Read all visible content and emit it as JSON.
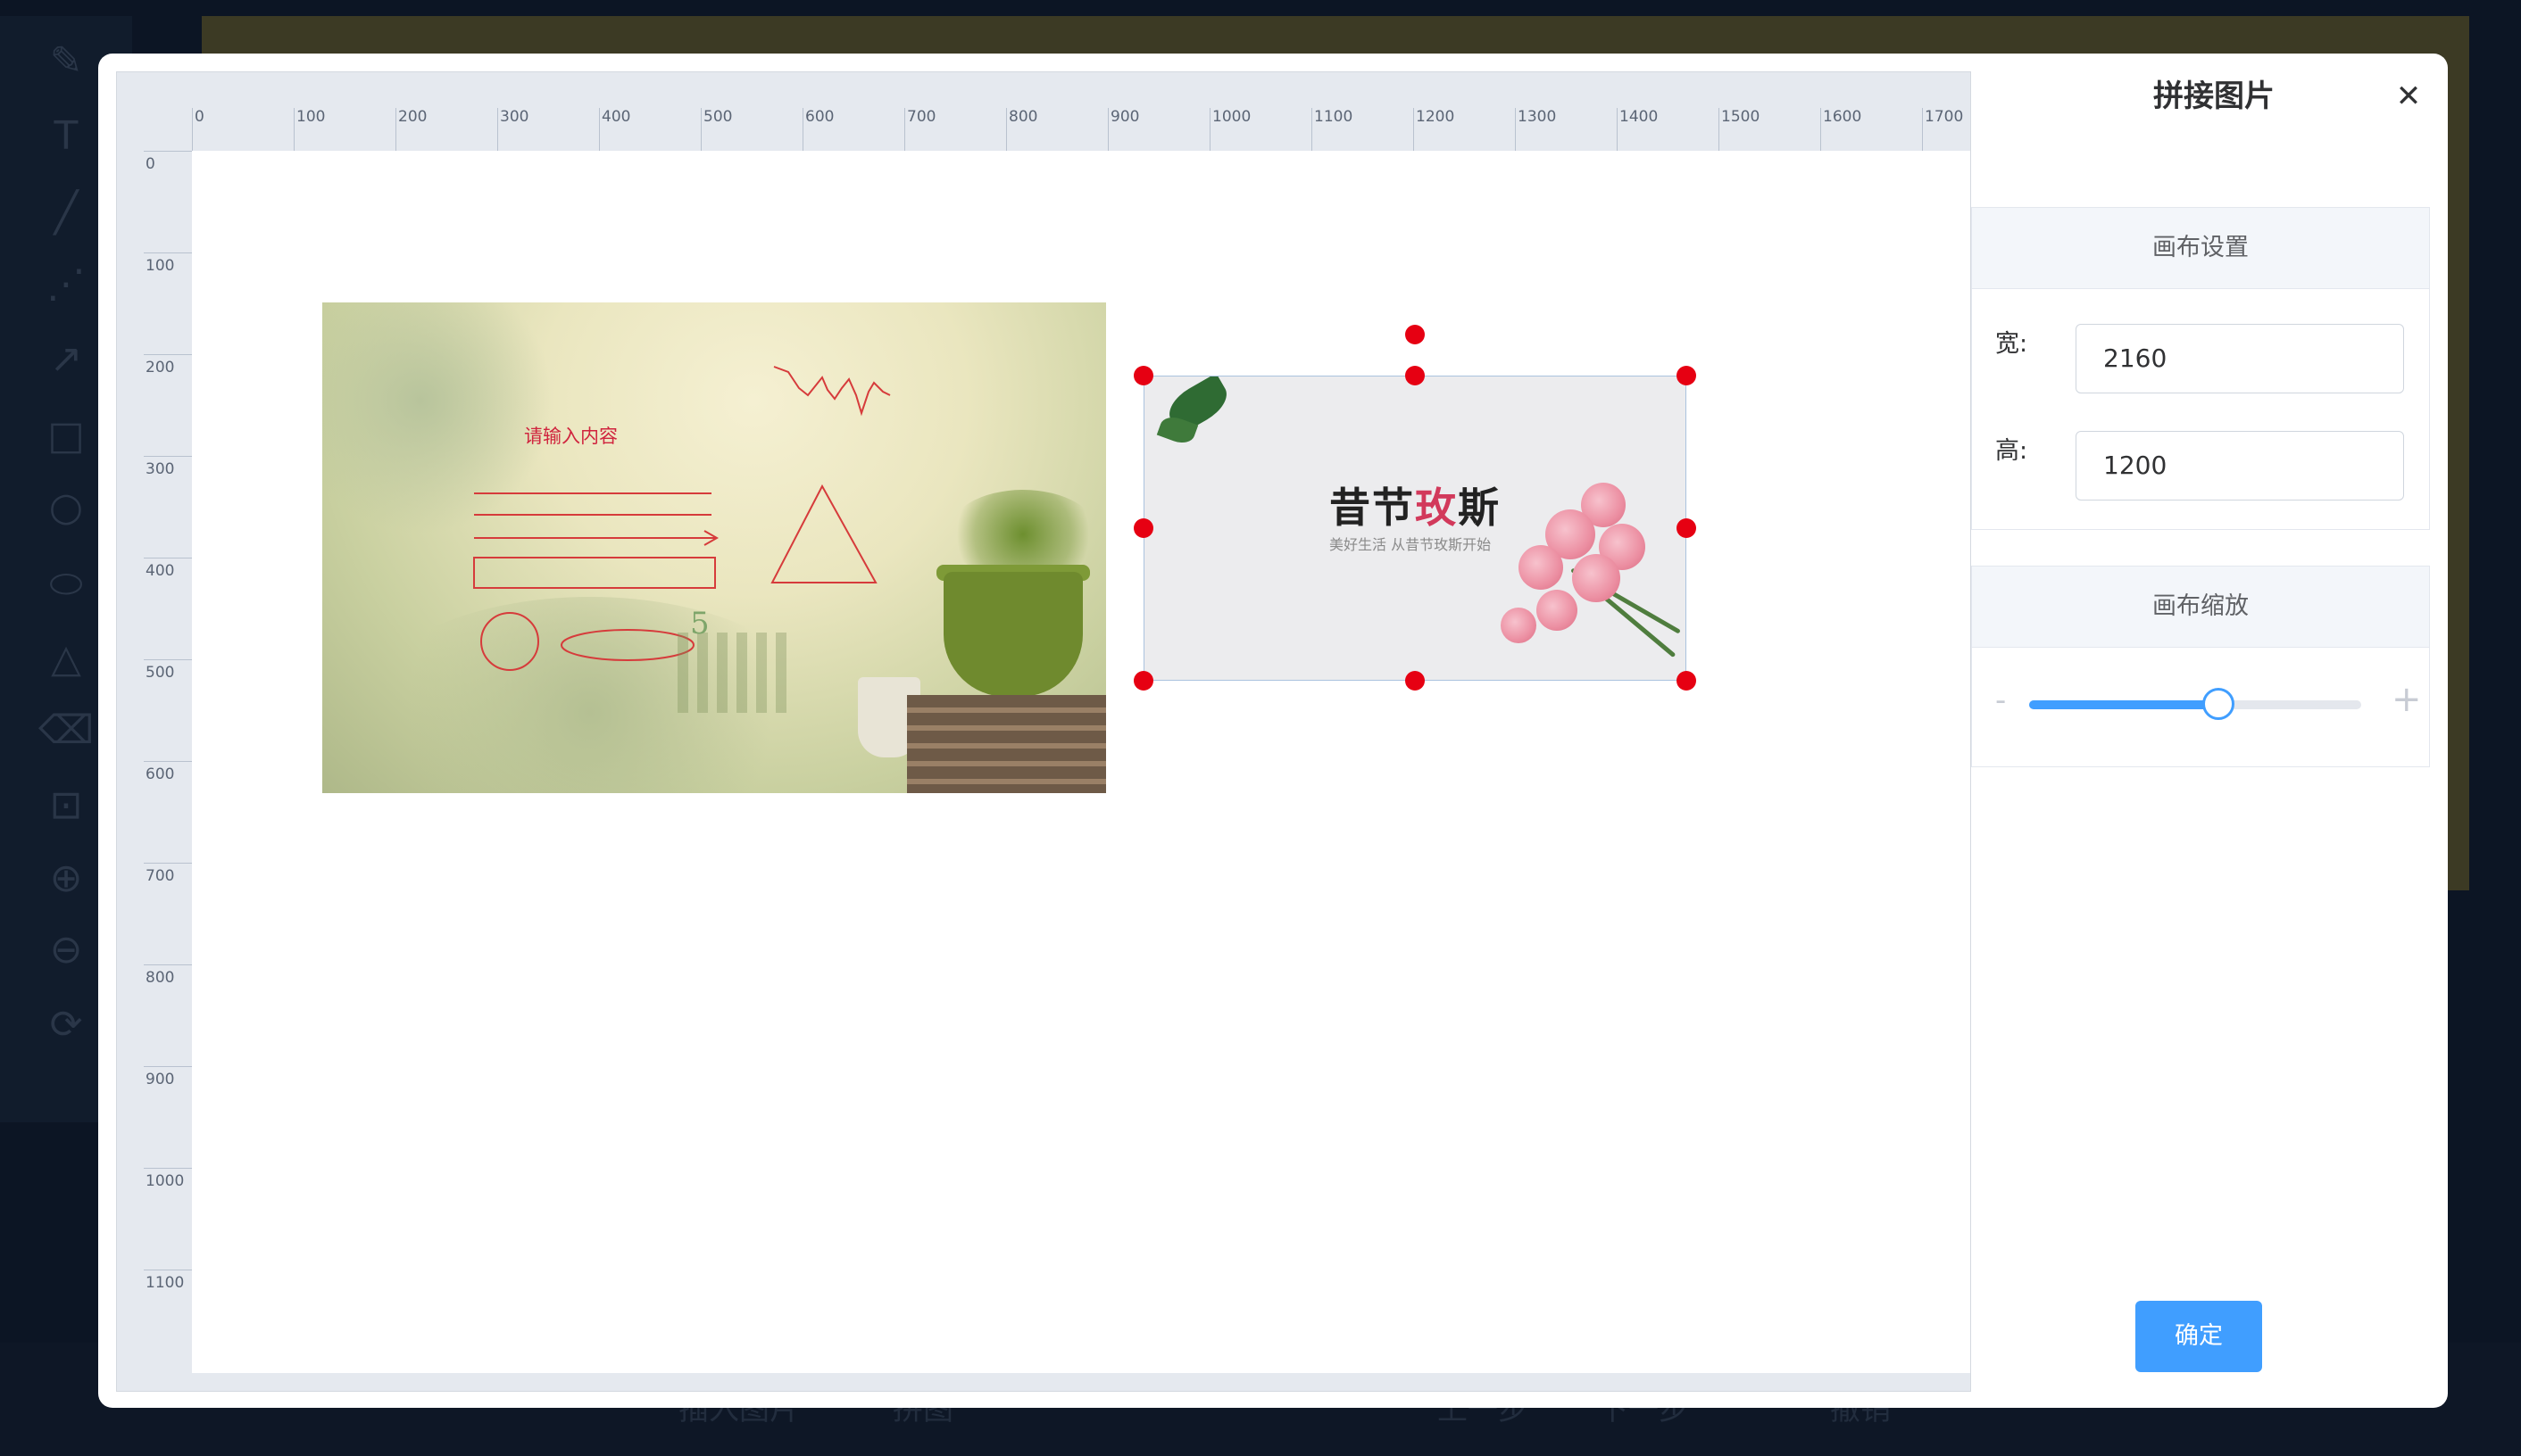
{
  "background_app": {
    "bottom_bar": [
      "插入图片",
      "拼图",
      "上一步",
      "下一步",
      "撤销"
    ]
  },
  "ruler": {
    "horizontal": [
      "0",
      "100",
      "200",
      "300",
      "400",
      "500",
      "600",
      "700",
      "800",
      "900",
      "1000",
      "1100",
      "1200",
      "1300",
      "1400",
      "1500",
      "1600",
      "1700"
    ],
    "vertical": [
      "0",
      "100",
      "200",
      "300",
      "400",
      "500",
      "600",
      "700",
      "800",
      "900",
      "1000",
      "1100"
    ]
  },
  "canvas": {
    "image1": {
      "annotation_text": "请输入内容",
      "digit": "5"
    },
    "image2": {
      "brand_a": "昔节",
      "brand_b": "玫",
      "brand_c": "斯",
      "slogan": "美好生活  从昔节玫斯开始"
    }
  },
  "panel": {
    "title": "拼接图片",
    "close_icon": "close-icon",
    "canvas_settings": {
      "header": "画布设置",
      "width_label": "宽:",
      "width_value": "2160",
      "height_label": "高:",
      "height_value": "1200"
    },
    "canvas_zoom": {
      "header": "画布缩放",
      "minus": "-",
      "plus": "+",
      "level": 0.57
    },
    "confirm_label": "确定"
  },
  "colors": {
    "accent": "#409eff",
    "handle": "#e60012",
    "annotation": "#d0243e"
  }
}
